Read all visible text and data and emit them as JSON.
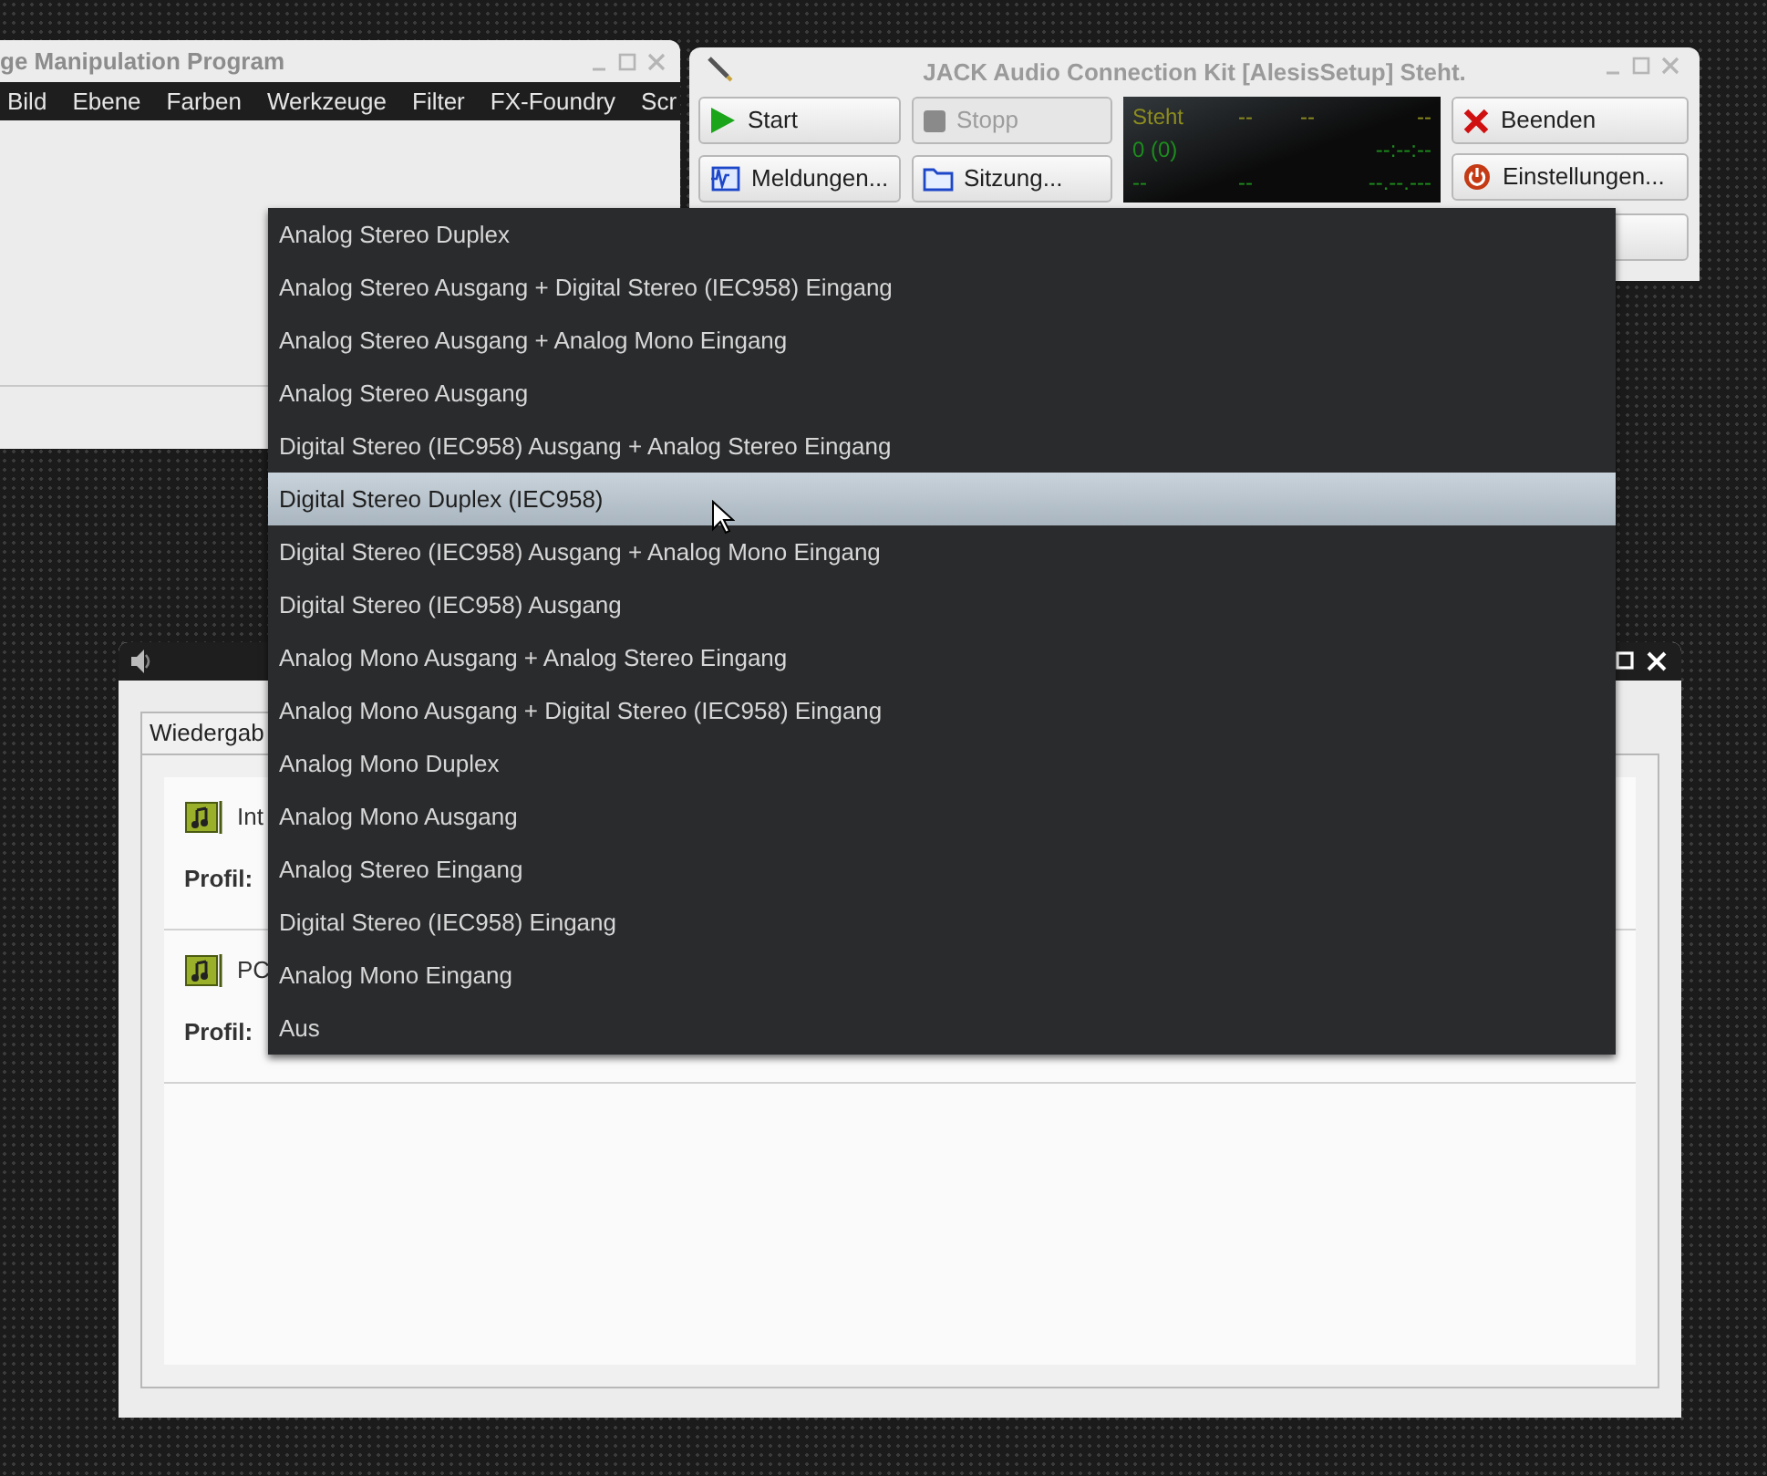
{
  "image_editor": {
    "title": "ge Manipulation Program",
    "menu": [
      "Bild",
      "Ebene",
      "Farben",
      "Werkzeuge",
      "Filter",
      "FX-Foundry",
      "Scr"
    ]
  },
  "jack": {
    "title": "JACK Audio Connection Kit [AlesisSetup] Steht.",
    "buttons": [
      {
        "label": "Start",
        "kind": "start",
        "disabled": false
      },
      {
        "label": "Stopp",
        "kind": "stop",
        "disabled": true
      },
      {
        "label": "Meldungen...",
        "kind": "messages",
        "disabled": false
      },
      {
        "label": "Sitzung...",
        "kind": "session",
        "disabled": false
      }
    ],
    "side_buttons": [
      {
        "label": "Beenden",
        "kind": "quit"
      },
      {
        "label": "Einstellungen...",
        "kind": "settings"
      }
    ],
    "display": {
      "rows": [
        [
          "Steht",
          "--",
          "--",
          "--"
        ],
        [
          "0 (0)",
          "",
          "",
          "--:--:--"
        ],
        [
          "--",
          "--",
          "",
          "--.--.---"
        ]
      ]
    }
  },
  "volume_control": {
    "tabs": [
      {
        "label": "Wiedergab",
        "selected": true
      }
    ],
    "cards": [
      {
        "name": "Int",
        "profile_label": "Profil:"
      },
      {
        "name": "PC",
        "profile_label": "Profil:"
      }
    ]
  },
  "dropdown": {
    "items": [
      {
        "label": "Analog Stereo Duplex",
        "selected": false
      },
      {
        "label": "Analog Stereo Ausgang + Digital Stereo (IEC958) Eingang",
        "selected": false
      },
      {
        "label": "Analog Stereo Ausgang + Analog Mono Eingang",
        "selected": false
      },
      {
        "label": "Analog Stereo Ausgang",
        "selected": false
      },
      {
        "label": "Digital Stereo (IEC958) Ausgang + Analog Stereo Eingang",
        "selected": false
      },
      {
        "label": "Digital Stereo Duplex (IEC958)",
        "selected": true
      },
      {
        "label": "Digital Stereo (IEC958) Ausgang + Analog Mono Eingang",
        "selected": false
      },
      {
        "label": "Digital Stereo (IEC958) Ausgang",
        "selected": false
      },
      {
        "label": "Analog Mono Ausgang + Analog Stereo Eingang",
        "selected": false
      },
      {
        "label": "Analog Mono Ausgang + Digital Stereo (IEC958) Eingang",
        "selected": false
      },
      {
        "label": "Analog Mono Duplex",
        "selected": false
      },
      {
        "label": "Analog Mono Ausgang",
        "selected": false
      },
      {
        "label": "Analog Stereo Eingang",
        "selected": false
      },
      {
        "label": "Digital Stereo (IEC958) Eingang",
        "selected": false
      },
      {
        "label": "Analog Mono Eingang",
        "selected": false
      },
      {
        "label": "Aus",
        "selected": false
      }
    ]
  }
}
